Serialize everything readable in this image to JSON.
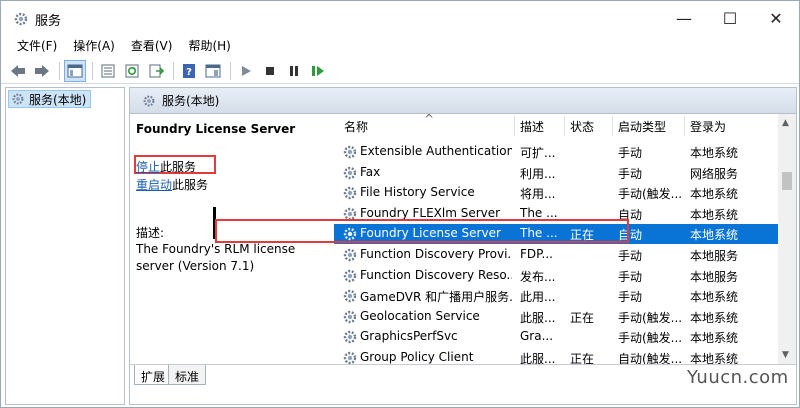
{
  "window": {
    "title": "服务",
    "controls": {
      "minimize": "—",
      "maximize": "☐",
      "close": "✕"
    }
  },
  "menu": [
    "文件(F)",
    "操作(A)",
    "查看(V)",
    "帮助(H)"
  ],
  "toolbar": [
    "back-icon",
    "forward-icon",
    "show-tree-icon",
    "properties-icon",
    "refresh-icon",
    "export-icon",
    "help-icon",
    "show-pane-icon",
    "start-icon",
    "stop-icon",
    "pause-icon",
    "resume-icon"
  ],
  "tree": {
    "root": "服务(本地)"
  },
  "pane": {
    "header": "服务(本地)",
    "service_title": "Foundry License Server",
    "stop_link": "停止",
    "stop_suffix": "此服务",
    "restart_link": "重启动",
    "restart_suffix": "此服务",
    "desc_label": "描述:",
    "desc_text": "The Foundry's RLM license server (Version 7.1)"
  },
  "columns": {
    "name": "名称",
    "desc": "描述",
    "status": "状态",
    "startup": "启动类型",
    "logon": "登录为"
  },
  "rows": [
    {
      "name": "Extensible Authentication...",
      "desc": "可扩...",
      "status": "",
      "startup": "手动",
      "logon": "本地系统"
    },
    {
      "name": "Fax",
      "desc": "利用...",
      "status": "",
      "startup": "手动",
      "logon": "网络服务"
    },
    {
      "name": "File History Service",
      "desc": "将用...",
      "status": "",
      "startup": "手动(触发...",
      "logon": "本地系统"
    },
    {
      "name": "Foundry FLEXlm Server",
      "desc": "The ...",
      "status": "",
      "startup": "自动",
      "logon": "本地系统"
    },
    {
      "name": "Foundry License Server",
      "desc": "The ...",
      "status": "正在",
      "startup": "自动",
      "logon": "本地系统"
    },
    {
      "name": "Function Discovery Provi...",
      "desc": "FDP...",
      "status": "",
      "startup": "手动",
      "logon": "本地服务"
    },
    {
      "name": "Function Discovery Reso...",
      "desc": "发布...",
      "status": "",
      "startup": "手动",
      "logon": "本地服务"
    },
    {
      "name": "GameDVR 和广播用户服务...",
      "desc": "此用...",
      "status": "",
      "startup": "手动",
      "logon": "本地系统"
    },
    {
      "name": "Geolocation Service",
      "desc": "此服...",
      "status": "正在",
      "startup": "手动(触发...",
      "logon": "本地系统"
    },
    {
      "name": "GraphicsPerfSvc",
      "desc": "Gra...",
      "status": "",
      "startup": "手动(触发...",
      "logon": "本地系统"
    },
    {
      "name": "Group Policy Client",
      "desc": "此服...",
      "status": "正在",
      "startup": "自动(触发...",
      "logon": "本地系统"
    }
  ],
  "selected_row": 4,
  "tabs": [
    "扩展",
    "标准"
  ],
  "watermark": "Yuucn.com",
  "colors": {
    "selection": "#0a74d6",
    "highlight_box": "#e23b3b",
    "link": "#1a5fb4"
  }
}
